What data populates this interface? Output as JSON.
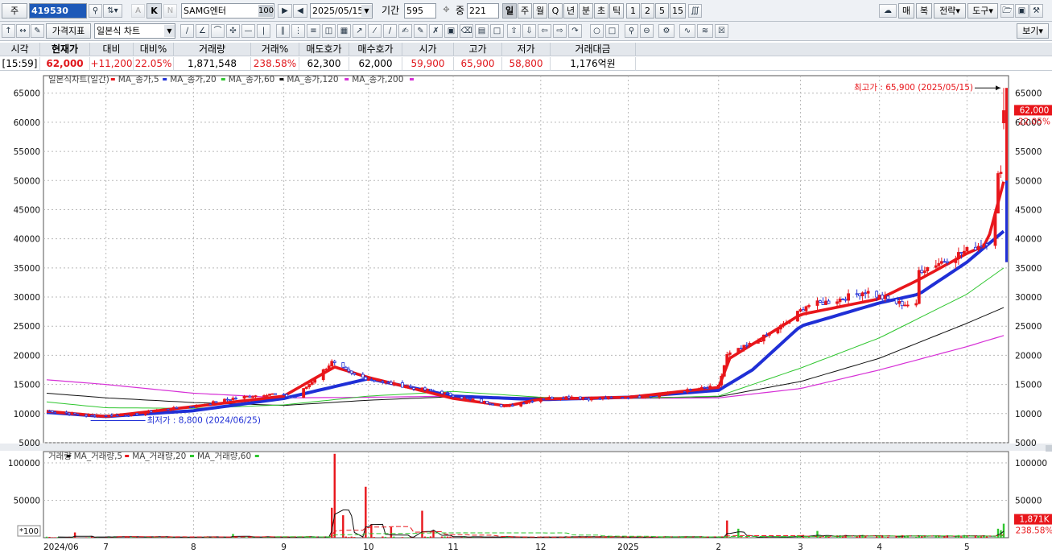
{
  "toolbar1": {
    "market_label": "주",
    "code": "419530",
    "k_label": "K",
    "n_label": "N",
    "stock_name": "SAMG엔터",
    "stock_pct": "100",
    "date": "2025/05/15",
    "period_label": "기간",
    "period_value": "595",
    "mid_label": "중",
    "mid_value": "221",
    "intervals": [
      "일",
      "주",
      "월",
      "Q",
      "년",
      "분",
      "초",
      "틱",
      "1",
      "2",
      "5",
      "15"
    ],
    "right_buttons": [
      "매",
      "복",
      "전략",
      "도구"
    ]
  },
  "toolbar2": {
    "indicator_label": "가격지표",
    "chart_type": "일본식 차트",
    "view_label": "보기"
  },
  "quote": {
    "headers": [
      "시각",
      "현재가",
      "대비",
      "대비%",
      "거래량",
      "거래%",
      "매도호가",
      "매수호가",
      "시가",
      "고가",
      "저가",
      "거래대금"
    ],
    "values": [
      "[15:59]",
      "62,000",
      "+11,200",
      "22.05%",
      "1,871,548",
      "238.58%",
      "62,300",
      "62,000",
      "59,900",
      "65,900",
      "58,800",
      "1,176억원"
    ]
  },
  "colors": {
    "up": "#e8161b",
    "down": "#1f2fd6",
    "ma5": "#e8161b",
    "ma20": "#1f2fd6",
    "ma60": "#2fc62f",
    "ma120": "#111111",
    "ma200": "#d62fd6"
  },
  "chart_data": [
    {
      "type": "candlestick",
      "title": "",
      "legend": [
        {
          "name": "일본식차트(일간)",
          "color": "#777777"
        },
        {
          "name": "MA_종가,5",
          "color": "#e8161b"
        },
        {
          "name": "MA_종가,20",
          "color": "#1f2fd6"
        },
        {
          "name": "MA_종가,60",
          "color": "#2fc62f"
        },
        {
          "name": "MA_종가,120",
          "color": "#111111"
        },
        {
          "name": "MA_종가,200",
          "color": "#d62fd6"
        }
      ],
      "legend_placement": "top-left",
      "ylim": [
        5000,
        68000
      ],
      "y_ticks": [
        65000,
        60000,
        55000,
        50000,
        45000,
        40000,
        35000,
        30000,
        25000,
        20000,
        15000,
        10000,
        5000
      ],
      "x_labels": [
        "2024/06",
        "7",
        "8",
        "9",
        "10",
        "11",
        "12",
        "2025",
        "2",
        "3",
        "4",
        "5"
      ],
      "x_range": [
        "2024-06-10",
        "2025-05-15"
      ],
      "x_label_dates": [
        "2024-06-10",
        "2024-07-01",
        "2024-08-01",
        "2024-09-02",
        "2024-10-02",
        "2024-11-01",
        "2024-12-02",
        "2025-01-02",
        "2025-02-03",
        "2025-03-04",
        "2025-04-01",
        "2025-05-02"
      ],
      "price_path": [
        [
          "2024-06-10",
          10500
        ],
        [
          "2024-06-25",
          9600
        ],
        [
          "2024-07-10",
          9800
        ],
        [
          "2024-07-20",
          10600
        ],
        [
          "2024-08-02",
          11300
        ],
        [
          "2024-08-15",
          12600
        ],
        [
          "2024-08-28",
          13400
        ],
        [
          "2024-09-06",
          12800
        ],
        [
          "2024-09-12",
          15500
        ],
        [
          "2024-09-19",
          18800
        ],
        [
          "2024-09-26",
          16800
        ],
        [
          "2024-10-03",
          15800
        ],
        [
          "2024-10-17",
          14500
        ],
        [
          "2024-10-28",
          13600
        ],
        [
          "2024-11-05",
          12600
        ],
        [
          "2024-11-14",
          11800
        ],
        [
          "2024-11-20",
          11200
        ],
        [
          "2024-12-02",
          12600
        ],
        [
          "2024-12-13",
          12900
        ],
        [
          "2024-12-20",
          12500
        ],
        [
          "2025-01-02",
          12800
        ],
        [
          "2025-01-13",
          13200
        ],
        [
          "2025-01-22",
          13900
        ],
        [
          "2025-02-03",
          14700
        ],
        [
          "2025-02-06",
          20000
        ],
        [
          "2025-02-17",
          22500
        ],
        [
          "2025-02-27",
          25500
        ],
        [
          "2025-03-06",
          28500
        ],
        [
          "2025-03-17",
          29500
        ],
        [
          "2025-03-27",
          31000
        ],
        [
          "2025-04-07",
          29000
        ],
        [
          "2025-04-14",
          28500
        ],
        [
          "2025-04-15",
          34500
        ],
        [
          "2025-04-25",
          36500
        ],
        [
          "2025-05-02",
          38000
        ],
        [
          "2025-05-09",
          39500
        ],
        [
          "2025-05-12",
          45000
        ],
        [
          "2025-05-13",
          50800
        ],
        [
          "2025-05-14",
          50800
        ],
        [
          "2025-05-15",
          62000
        ]
      ],
      "last_candle": {
        "date": "2025-05-15",
        "open": 59900,
        "high": 65900,
        "low": 58800,
        "close": 62000
      },
      "ma_series": [
        {
          "name": "MA_종가,5",
          "points": [
            [
              "2024-06-10",
              10400
            ],
            [
              "2024-07-01",
              9500
            ],
            [
              "2024-08-01",
              11200
            ],
            [
              "2024-09-02",
              13000
            ],
            [
              "2024-09-20",
              18000
            ],
            [
              "2024-10-02",
              16200
            ],
            [
              "2024-11-01",
              12600
            ],
            [
              "2024-11-20",
              11300
            ],
            [
              "2024-12-02",
              12500
            ],
            [
              "2025-01-02",
              12800
            ],
            [
              "2025-02-03",
              14500
            ],
            [
              "2025-02-07",
              19500
            ],
            [
              "2025-03-04",
              27000
            ],
            [
              "2025-04-01",
              29700
            ],
            [
              "2025-04-15",
              33000
            ],
            [
              "2025-05-02",
              37500
            ],
            [
              "2025-05-09",
              39000
            ],
            [
              "2025-05-15",
              49800
            ]
          ]
        },
        {
          "name": "MA_종가,20",
          "points": [
            [
              "2024-06-10",
              10200
            ],
            [
              "2024-07-01",
              9500
            ],
            [
              "2024-08-01",
              10500
            ],
            [
              "2024-09-02",
              12600
            ],
            [
              "2024-10-02",
              16000
            ],
            [
              "2024-11-01",
              13000
            ],
            [
              "2024-12-02",
              12400
            ],
            [
              "2025-01-02",
              12800
            ],
            [
              "2025-02-03",
              14000
            ],
            [
              "2025-02-15",
              17500
            ],
            [
              "2025-03-04",
              25000
            ],
            [
              "2025-04-01",
              29000
            ],
            [
              "2025-04-15",
              30500
            ],
            [
              "2025-05-02",
              36000
            ],
            [
              "2025-05-15",
              41300
            ]
          ]
        },
        {
          "name": "MA_종가,60",
          "points": [
            [
              "2024-06-10",
              12000
            ],
            [
              "2024-07-01",
              11000
            ],
            [
              "2024-08-01",
              10900
            ],
            [
              "2024-09-02",
              11500
            ],
            [
              "2024-10-02",
              13000
            ],
            [
              "2024-11-01",
              13800
            ],
            [
              "2024-12-02",
              12800
            ],
            [
              "2025-01-02",
              12600
            ],
            [
              "2025-02-03",
              13000
            ],
            [
              "2025-03-04",
              17800
            ],
            [
              "2025-04-01",
              23000
            ],
            [
              "2025-05-02",
              30500
            ],
            [
              "2025-05-15",
              35000
            ]
          ]
        },
        {
          "name": "MA_종가,120",
          "points": [
            [
              "2024-06-10",
              13500
            ],
            [
              "2024-07-01",
              12700
            ],
            [
              "2024-08-01",
              11900
            ],
            [
              "2024-09-02",
              11400
            ],
            [
              "2024-10-02",
              12300
            ],
            [
              "2024-11-01",
              12900
            ],
            [
              "2024-12-02",
              12700
            ],
            [
              "2025-01-02",
              12700
            ],
            [
              "2025-02-03",
              12900
            ],
            [
              "2025-03-04",
              15500
            ],
            [
              "2025-04-01",
              19500
            ],
            [
              "2025-05-02",
              25500
            ],
            [
              "2025-05-15",
              28200
            ]
          ]
        },
        {
          "name": "MA_종가,200",
          "points": [
            [
              "2024-06-10",
              15800
            ],
            [
              "2024-07-01",
              15000
            ],
            [
              "2024-08-01",
              13500
            ],
            [
              "2024-09-02",
              12700
            ],
            [
              "2024-10-02",
              12800
            ],
            [
              "2024-11-01",
              13000
            ],
            [
              "2024-12-02",
              12700
            ],
            [
              "2025-01-02",
              12600
            ],
            [
              "2025-02-03",
              12700
            ],
            [
              "2025-03-04",
              14300
            ],
            [
              "2025-04-01",
              17500
            ],
            [
              "2025-05-02",
              21500
            ],
            [
              "2025-05-15",
              23400
            ]
          ]
        }
      ],
      "annotations": {
        "high_label": "최고가 : 65,900 (2025/05/15)",
        "low_label": "최저가 : 8,800 (2024/06/25)",
        "price_tag": "62,000",
        "pct_tag": "22.05%"
      }
    },
    {
      "type": "bar",
      "title": "",
      "legend": [
        {
          "name": "거래량",
          "color": "#e8161b"
        },
        {
          "name": "MA_거래량,5",
          "color": "#111111"
        },
        {
          "name": "MA_거래량,20",
          "color": "#e8161b"
        },
        {
          "name": "MA_거래량,60",
          "color": "#2fc62f"
        }
      ],
      "ylabel": "*100",
      "ylim": [
        0,
        115000
      ],
      "y_ticks": [
        100000,
        50000
      ],
      "x_range": [
        "2024-06-10",
        "2025-05-15"
      ],
      "spikes": [
        [
          "2024-06-20",
          7000
        ],
        [
          "2024-07-20",
          6000
        ],
        [
          "2024-08-15",
          5000
        ],
        [
          "2024-09-19",
          40000
        ],
        [
          "2024-09-20",
          112000
        ],
        [
          "2024-09-23",
          30000
        ],
        [
          "2024-10-01",
          68000
        ],
        [
          "2024-10-03",
          18000
        ],
        [
          "2024-10-10",
          14000
        ],
        [
          "2024-10-21",
          36000
        ],
        [
          "2024-10-25",
          10000
        ],
        [
          "2025-02-06",
          23000
        ],
        [
          "2025-02-10",
          12000
        ],
        [
          "2025-03-10",
          9000
        ],
        [
          "2025-05-13",
          12000
        ],
        [
          "2025-05-14",
          10000
        ],
        [
          "2025-05-15",
          18715
        ]
      ],
      "annotations": {
        "volume_tag": "1,871K",
        "pct_tag": "238.58%"
      }
    }
  ]
}
